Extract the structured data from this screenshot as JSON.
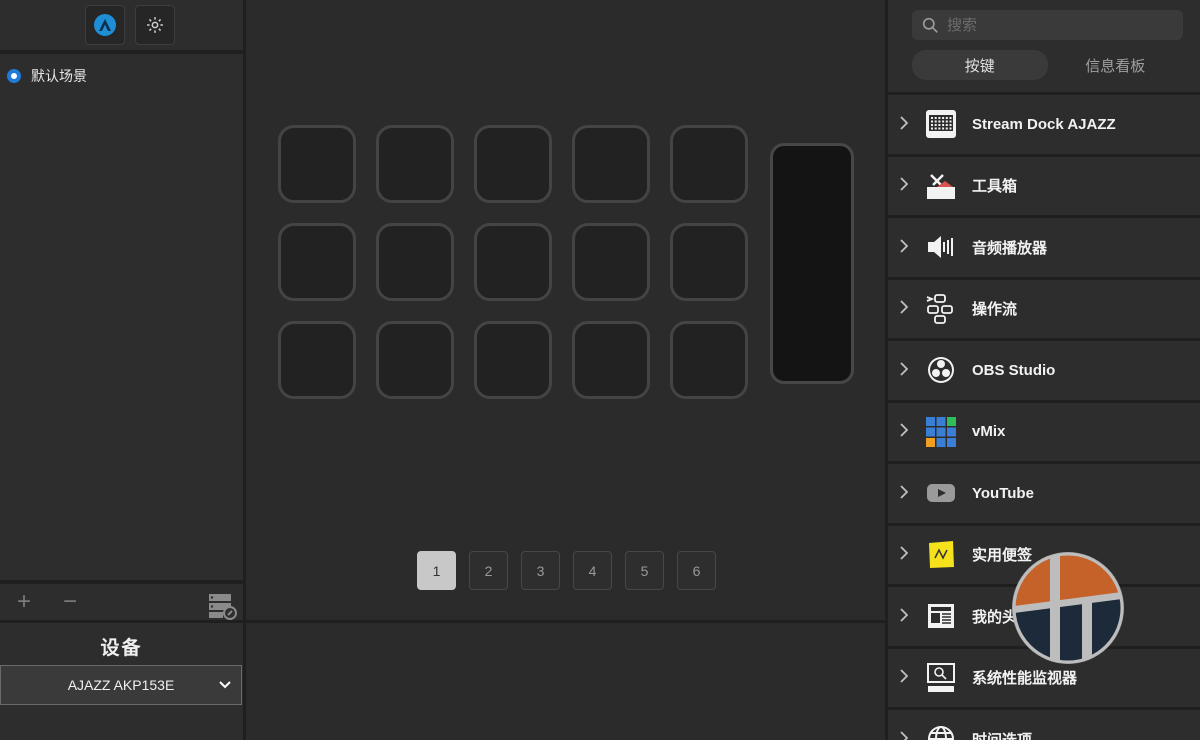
{
  "left": {
    "logo_icon": "app-logo-icon",
    "settings_icon": "gear-icon",
    "scenes": [
      {
        "label": "默认场景",
        "selected": true
      }
    ],
    "add_label": "+",
    "remove_label": "−",
    "device_title": "设备",
    "device_value": "AJAZZ AKP153E"
  },
  "center": {
    "pages": [
      "1",
      "2",
      "3",
      "4",
      "5",
      "6"
    ],
    "active_page": "1"
  },
  "right": {
    "search_placeholder": "搜索",
    "tabs": [
      "按键",
      "信息看板"
    ],
    "active_tab": "按键",
    "categories": [
      {
        "label": "Stream Dock AJAZZ",
        "icon": "keyboard-grid-icon"
      },
      {
        "label": "工具箱",
        "icon": "toolbox-icon"
      },
      {
        "label": "音频播放器",
        "icon": "speaker-icon"
      },
      {
        "label": "操作流",
        "icon": "workflow-icon"
      },
      {
        "label": "OBS Studio",
        "icon": "obs-icon"
      },
      {
        "label": "vMix",
        "icon": "vmix-icon"
      },
      {
        "label": "YouTube",
        "icon": "youtube-icon"
      },
      {
        "label": "实用便签",
        "icon": "sticky-note-icon"
      },
      {
        "label": "我的头条",
        "icon": "news-icon"
      },
      {
        "label": "系统性能监视器",
        "icon": "monitor-icon"
      },
      {
        "label": "时间选项",
        "icon": "globe-icon"
      }
    ]
  },
  "colors": {
    "accent_blue": "#1f7ad8",
    "panel_bg": "#2d2d2d",
    "key_bg": "#222222"
  }
}
